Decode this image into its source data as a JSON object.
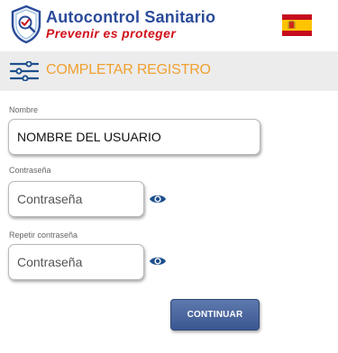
{
  "header": {
    "brand_title": "Autocontrol Sanitario",
    "brand_slogan": "Prevenir es proteger",
    "logo_icon": "shield-check-magnifier-icon",
    "language_flag": "spain-flag-icon"
  },
  "section": {
    "title": "COMPLETAR REGISTRO",
    "icon": "sliders-icon"
  },
  "form": {
    "name_label": "Nombre",
    "name_value": "NOMBRE DEL USUARIO",
    "password_label": "Contraseña",
    "password_placeholder": "Contraseña",
    "repeat_password_label": "Repetir contraseña",
    "repeat_password_placeholder": "Contraseña",
    "show_password_icon": "eye-icon",
    "submit_label": "CONTINUAR"
  },
  "colors": {
    "brand_blue": "#2b4b9a",
    "slogan_red": "#d0111b",
    "section_title_orange": "#f0a030",
    "icon_blue": "#1d4f8c",
    "button_blue": "#4a649e"
  }
}
